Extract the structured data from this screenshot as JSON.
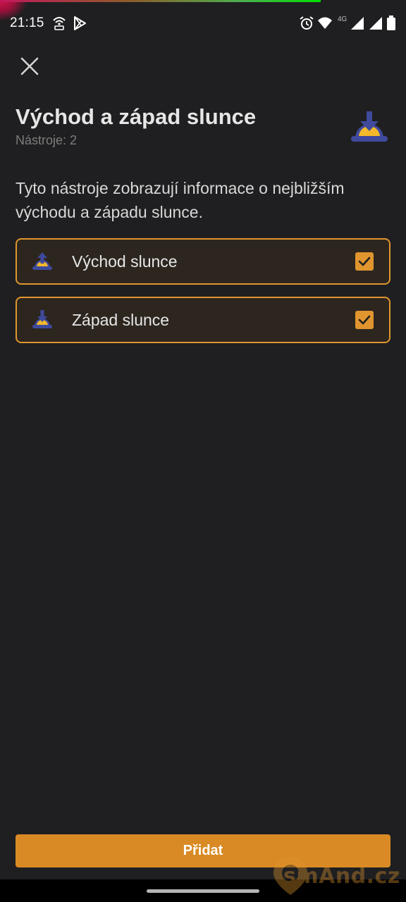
{
  "status_bar": {
    "time": "21:15",
    "network": "4G",
    "icons": [
      "hotspot-icon",
      "play-store-icon",
      "alarm-icon",
      "wifi-icon",
      "signal-icon",
      "signal-icon",
      "battery-icon"
    ]
  },
  "header": {
    "close_icon": "close-icon",
    "title": "Východ a západ slunce",
    "subtitle": "Nástroje: 2",
    "icon": "sunset-icon"
  },
  "description": "Tyto nástroje zobrazují informace o nejbližším východu a západu slunce.",
  "tools": [
    {
      "label": "Východ slunce",
      "icon": "sunrise-icon",
      "checked": true
    },
    {
      "label": "Západ slunce",
      "icon": "sunset-icon",
      "checked": true
    }
  ],
  "primary_button": {
    "label": "Přidat"
  },
  "watermark": {
    "text": "smAnd.cz"
  },
  "colors": {
    "accent": "#e0952e",
    "button": "#d98a24",
    "background": "#1f1f21",
    "icon_blue": "#3f4a9c",
    "icon_yellow": "#f3b82b"
  }
}
